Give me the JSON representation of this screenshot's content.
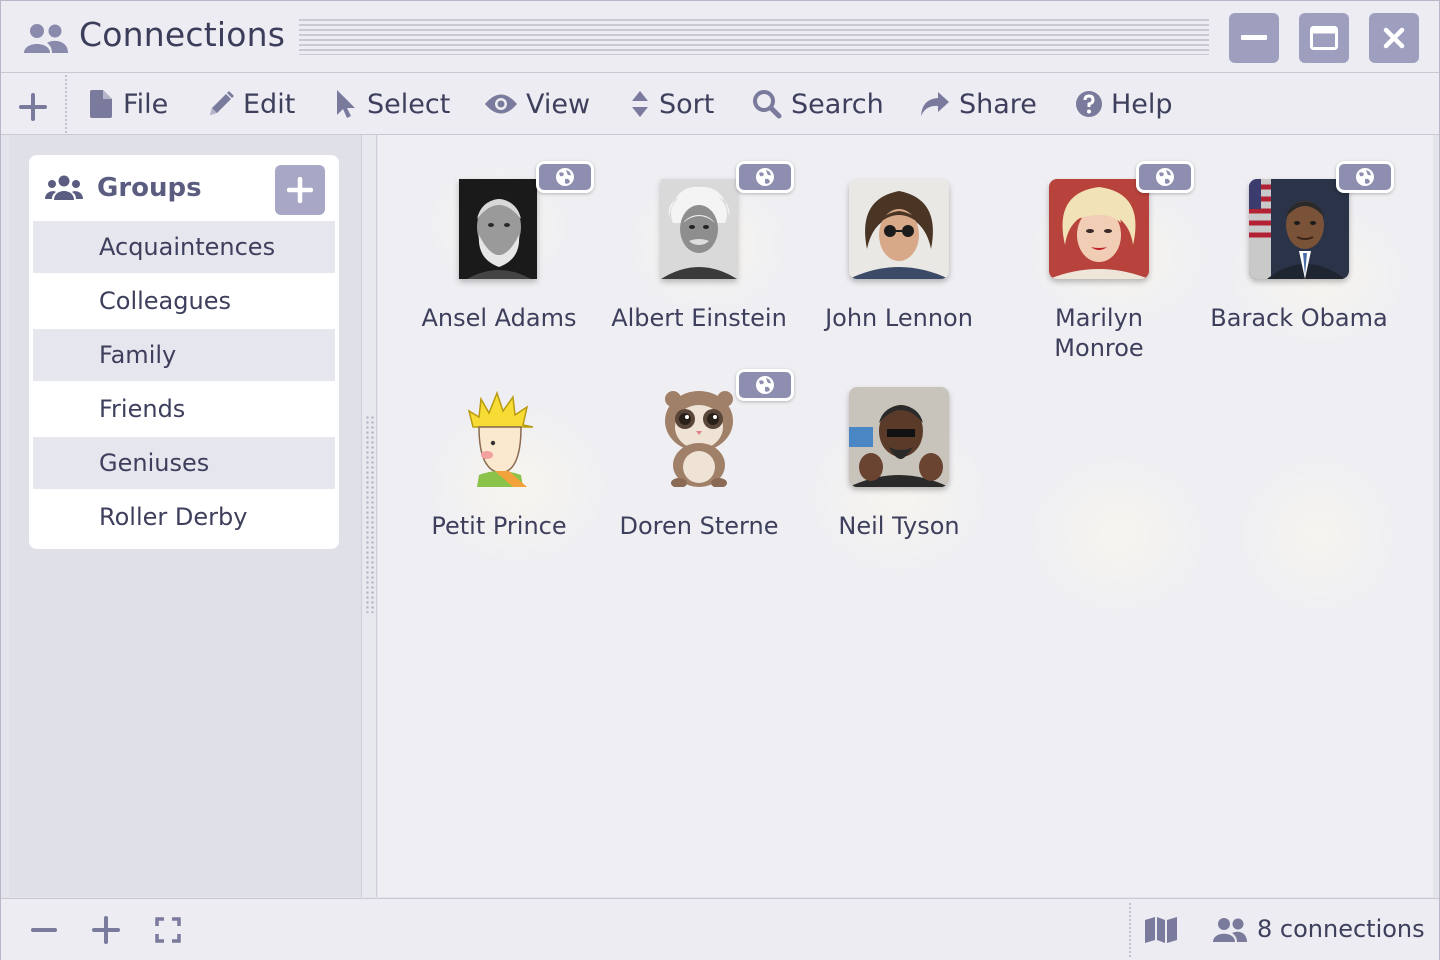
{
  "window": {
    "title": "Connections",
    "accent_color": "#9e9ebe"
  },
  "toolbar": {
    "menus": [
      {
        "label": "File",
        "icon": "file-icon"
      },
      {
        "label": "Edit",
        "icon": "pencil-icon"
      },
      {
        "label": "Select",
        "icon": "cursor-icon"
      },
      {
        "label": "View",
        "icon": "eye-icon"
      },
      {
        "label": "Sort",
        "icon": "sort-icon"
      },
      {
        "label": "Search",
        "icon": "search-icon"
      },
      {
        "label": "Share",
        "icon": "share-icon"
      },
      {
        "label": "Help",
        "icon": "help-icon"
      }
    ]
  },
  "sidebar": {
    "title": "Groups",
    "items": [
      {
        "label": "Acquaintences"
      },
      {
        "label": "Colleagues"
      },
      {
        "label": "Family"
      },
      {
        "label": "Friends"
      },
      {
        "label": "Geniuses"
      },
      {
        "label": "Roller Derby"
      }
    ]
  },
  "contacts": [
    {
      "name": "Ansel Adams",
      "shared": true,
      "avatar": "portrait-bw"
    },
    {
      "name": "Albert Einstein",
      "shared": true,
      "avatar": "portrait-bw"
    },
    {
      "name": "John Lennon",
      "shared": false,
      "avatar": "portrait-color"
    },
    {
      "name": "Marilyn Monroe",
      "shared": true,
      "avatar": "portrait-color"
    },
    {
      "name": "Barack Obama",
      "shared": true,
      "avatar": "portrait-color"
    },
    {
      "name": "Petit Prince",
      "shared": false,
      "avatar": "cartoon"
    },
    {
      "name": "Doren Sterne",
      "shared": true,
      "avatar": "cartoon"
    },
    {
      "name": "Neil Tyson",
      "shared": false,
      "avatar": "portrait-color"
    }
  ],
  "status": {
    "count_text": "8 connections"
  }
}
